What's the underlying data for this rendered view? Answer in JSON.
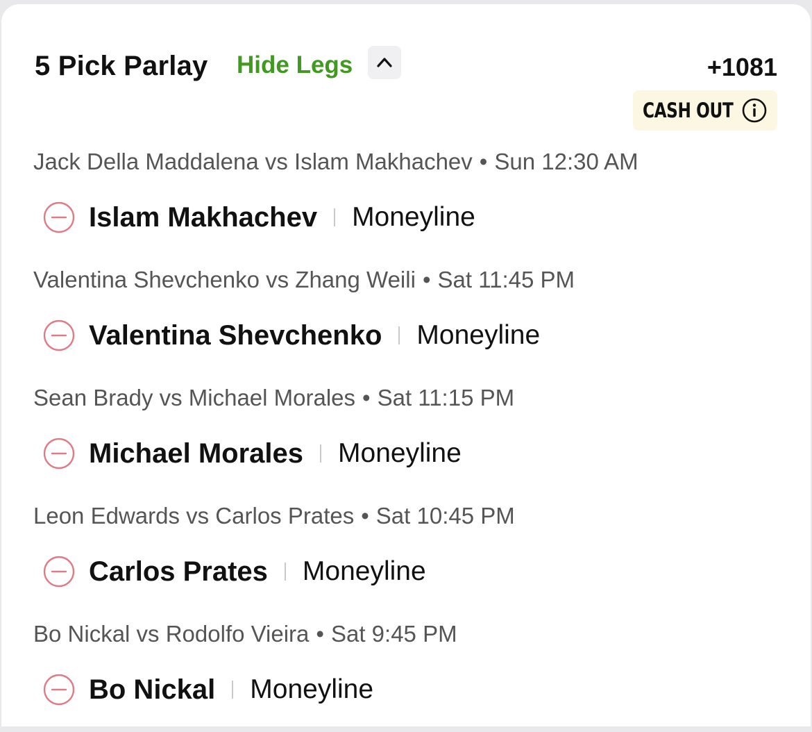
{
  "parlay": {
    "title": "5 Pick Parlay",
    "hide_legs_label": "Hide Legs",
    "odds": "+1081",
    "cashout_label": "CASH OUT",
    "accent_green": "#3f9a1f",
    "remove_icon_color": "#e07a86"
  },
  "legs": [
    {
      "matchup": "Jack Della Maddalena vs Islam Makhachev",
      "time": "Sun 12:30 AM",
      "pick": "Islam Makhachev",
      "market": "Moneyline"
    },
    {
      "matchup": "Valentina Shevchenko vs Zhang Weili",
      "time": "Sat 11:45 PM",
      "pick": "Valentina Shevchenko",
      "market": "Moneyline"
    },
    {
      "matchup": "Sean Brady vs Michael Morales",
      "time": "Sat 11:15 PM",
      "pick": "Michael Morales",
      "market": "Moneyline"
    },
    {
      "matchup": "Leon Edwards vs Carlos Prates",
      "time": "Sat 10:45 PM",
      "pick": "Carlos Prates",
      "market": "Moneyline"
    },
    {
      "matchup": "Bo Nickal vs Rodolfo Vieira",
      "time": "Sat 9:45 PM",
      "pick": "Bo Nickal",
      "market": "Moneyline"
    }
  ]
}
